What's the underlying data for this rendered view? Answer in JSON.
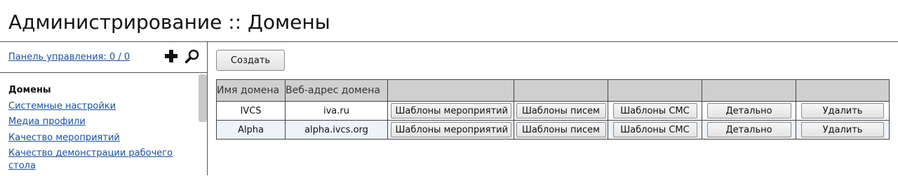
{
  "page": {
    "title": "Администрирование :: Домены"
  },
  "sidebar": {
    "dashboard_link": "Панель управления: 0 / 0",
    "add_icon": "plus-icon",
    "search_icon": "magnifier-icon",
    "items": [
      {
        "label": "Домены",
        "active": true
      },
      {
        "label": "Системные настройки",
        "active": false
      },
      {
        "label": "Медиа профили",
        "active": false
      },
      {
        "label": "Качество мероприятий",
        "active": false
      },
      {
        "label": "Качество демонстрации рабочего стола",
        "active": false
      }
    ]
  },
  "main": {
    "create_button": "Создать",
    "table": {
      "columns": [
        "Имя домена",
        "Веб-адрес домена",
        "",
        "",
        "",
        "",
        ""
      ],
      "rows": [
        {
          "name": "IVCS",
          "url": "iva.ru",
          "actions": [
            "Шаблоны мероприятий",
            "Шаблоны писем",
            "Шаблоны СМС",
            "Детально",
            "Удалить"
          ]
        },
        {
          "name": "Alpha",
          "url": "alpha.ivcs.org",
          "actions": [
            "Шаблоны мероприятий",
            "Шаблоны писем",
            "Шаблоны СМС",
            "Детально",
            "Удалить"
          ]
        }
      ]
    }
  },
  "colors": {
    "link": "#1a4fa0",
    "header_bg": "#cfcfcf",
    "alt_row_bg": "#eef3fa"
  }
}
